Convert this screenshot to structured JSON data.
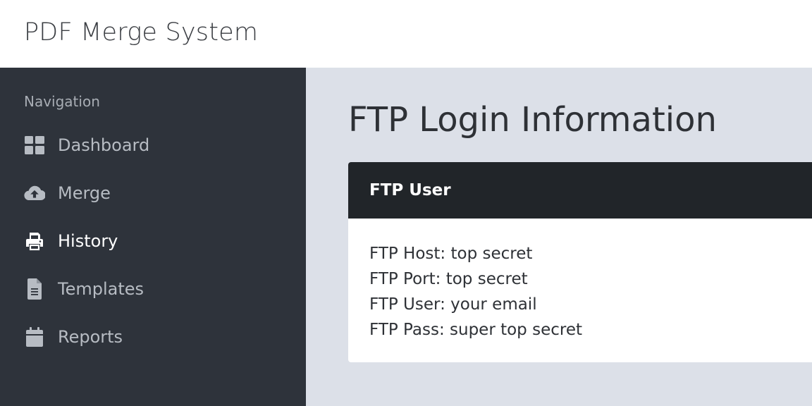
{
  "app": {
    "title": "PDF Merge System"
  },
  "sidebar": {
    "heading": "Navigation",
    "items": [
      {
        "label": "Dashboard",
        "icon": "dashboard-icon",
        "active": false
      },
      {
        "label": "Merge",
        "icon": "cloud-upload-icon",
        "active": false
      },
      {
        "label": "History",
        "icon": "printer-icon",
        "active": true
      },
      {
        "label": "Templates",
        "icon": "document-icon",
        "active": false
      },
      {
        "label": "Reports",
        "icon": "calendar-icon",
        "active": false
      }
    ]
  },
  "main": {
    "title": "FTP Login Information",
    "card": {
      "title": "FTP User",
      "lines": [
        "FTP Host: top secret",
        "FTP Port: top secret",
        "FTP User: your email",
        "FTP Pass: super top secret"
      ]
    }
  },
  "colors": {
    "sidebar_bg": "#2e333b",
    "main_bg": "#dce0e8",
    "card_header_bg": "#212529",
    "nav_text": "#b7bcc3",
    "nav_active_text": "#ffffff"
  }
}
